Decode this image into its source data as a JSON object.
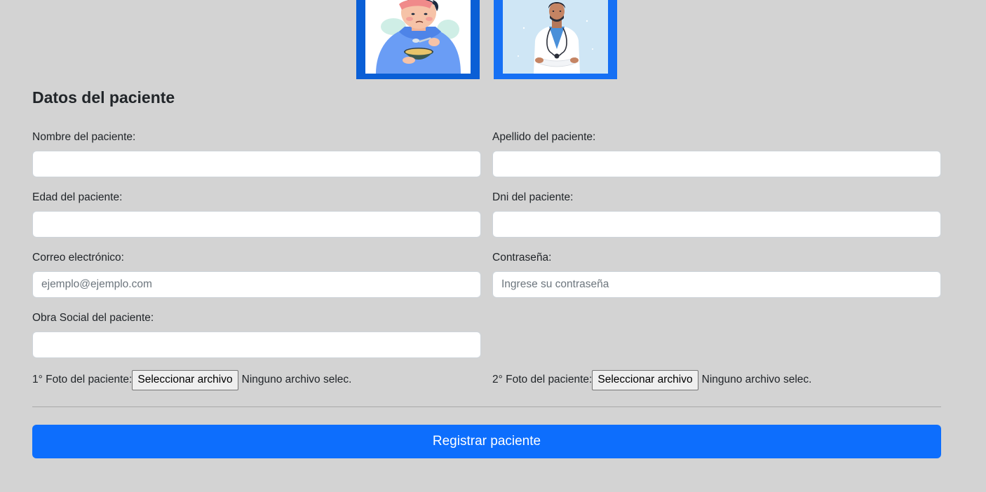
{
  "role_cards": {
    "patient": {
      "icon": "sick-patient-illustration"
    },
    "doctor": {
      "icon": "doctor-illustration"
    }
  },
  "form": {
    "title": "Datos del paciente",
    "fields": {
      "nombre": {
        "label": "Nombre del paciente:",
        "value": "",
        "placeholder": ""
      },
      "apellido": {
        "label": "Apellido del paciente:",
        "value": "",
        "placeholder": ""
      },
      "edad": {
        "label": "Edad del paciente:",
        "value": "",
        "placeholder": ""
      },
      "dni": {
        "label": "Dni del paciente:",
        "value": "",
        "placeholder": ""
      },
      "correo": {
        "label": "Correo electrónico:",
        "value": "",
        "placeholder": "ejemplo@ejemplo.com"
      },
      "contrasena": {
        "label": "Contraseña:",
        "value": "",
        "placeholder": "Ingrese su contraseña"
      },
      "obra_social": {
        "label": "Obra Social del paciente:",
        "value": "",
        "placeholder": ""
      }
    },
    "photos": {
      "foto1": {
        "label": "1° Foto del paciente:",
        "button": "Seleccionar archivo",
        "status": "Ninguno archivo selec."
      },
      "foto2": {
        "label": "2° Foto del paciente:",
        "button": "Seleccionar archivo",
        "status": "Ninguno archivo selec."
      }
    },
    "submit_label": "Registrar paciente"
  },
  "colors": {
    "page_bg": "#d3d3d3",
    "primary": "#0d6efd",
    "patient_frame": "#0a5fd6",
    "doctor_frame": "#1670f4"
  }
}
